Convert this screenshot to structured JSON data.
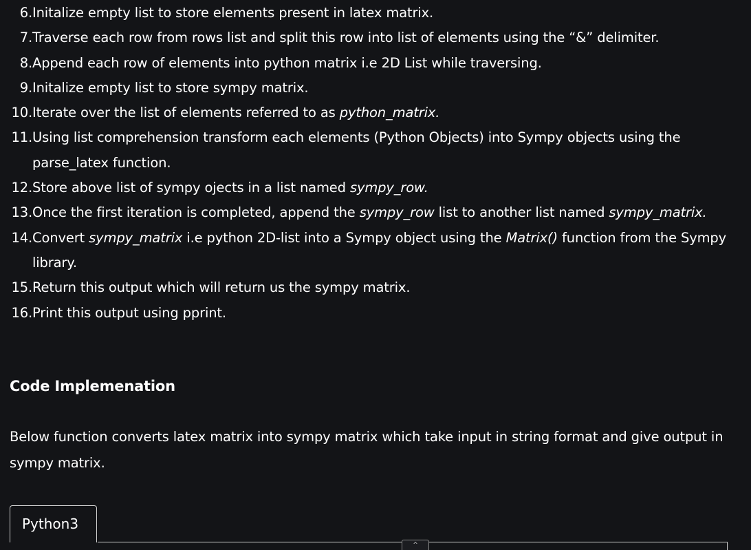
{
  "steps": [
    {
      "num": "6.",
      "parts": [
        "Initalize empty list to store elements present in latex matrix."
      ]
    },
    {
      "num": "7.",
      "parts": [
        "Traverse each row from rows list and split this row into list of elements using the “&” delimiter."
      ]
    },
    {
      "num": "8.",
      "parts": [
        "Append each row of elements into python matrix i.e 2D List while traversing."
      ]
    },
    {
      "num": "9.",
      "parts": [
        "Initalize empty list to store sympy matrix."
      ]
    },
    {
      "num": "10.",
      "parts": [
        "Iterate over the list of elements referred to as ",
        "python_matrix."
      ]
    },
    {
      "num": "11.",
      "parts": [
        "Using list comprehension transform each elements (Python Objects) into Sympy objects using the parse_latex function."
      ]
    },
    {
      "num": "12.",
      "parts": [
        "Store above list of sympy ojects in a list named ",
        "sympy_row."
      ]
    },
    {
      "num": "13.",
      "parts": [
        "Once the first iteration is completed, append the ",
        "sympy_row",
        " list to another list named ",
        "sympy_matrix."
      ]
    },
    {
      "num": "14.",
      "parts": [
        "Convert ",
        "sympy_matrix",
        " i.e python 2D-list into a Sympy object using the ",
        "Matrix()",
        " function from the Sympy library."
      ]
    },
    {
      "num": "15.",
      "parts": [
        "Return this output which will return us the sympy matrix."
      ]
    },
    {
      "num": "16.",
      "parts": [
        "Print this output using pprint."
      ]
    }
  ],
  "section_title": "Code Implemenation",
  "description": "Below function converts latex matrix into sympy matrix which take input in string format and give output in sympy matrix.",
  "code_tab_label": "Python3",
  "scroll_up_glyph": "^",
  "colors": {
    "background": "#131417",
    "text": "#ffffff",
    "border": "#d0d0d0"
  }
}
